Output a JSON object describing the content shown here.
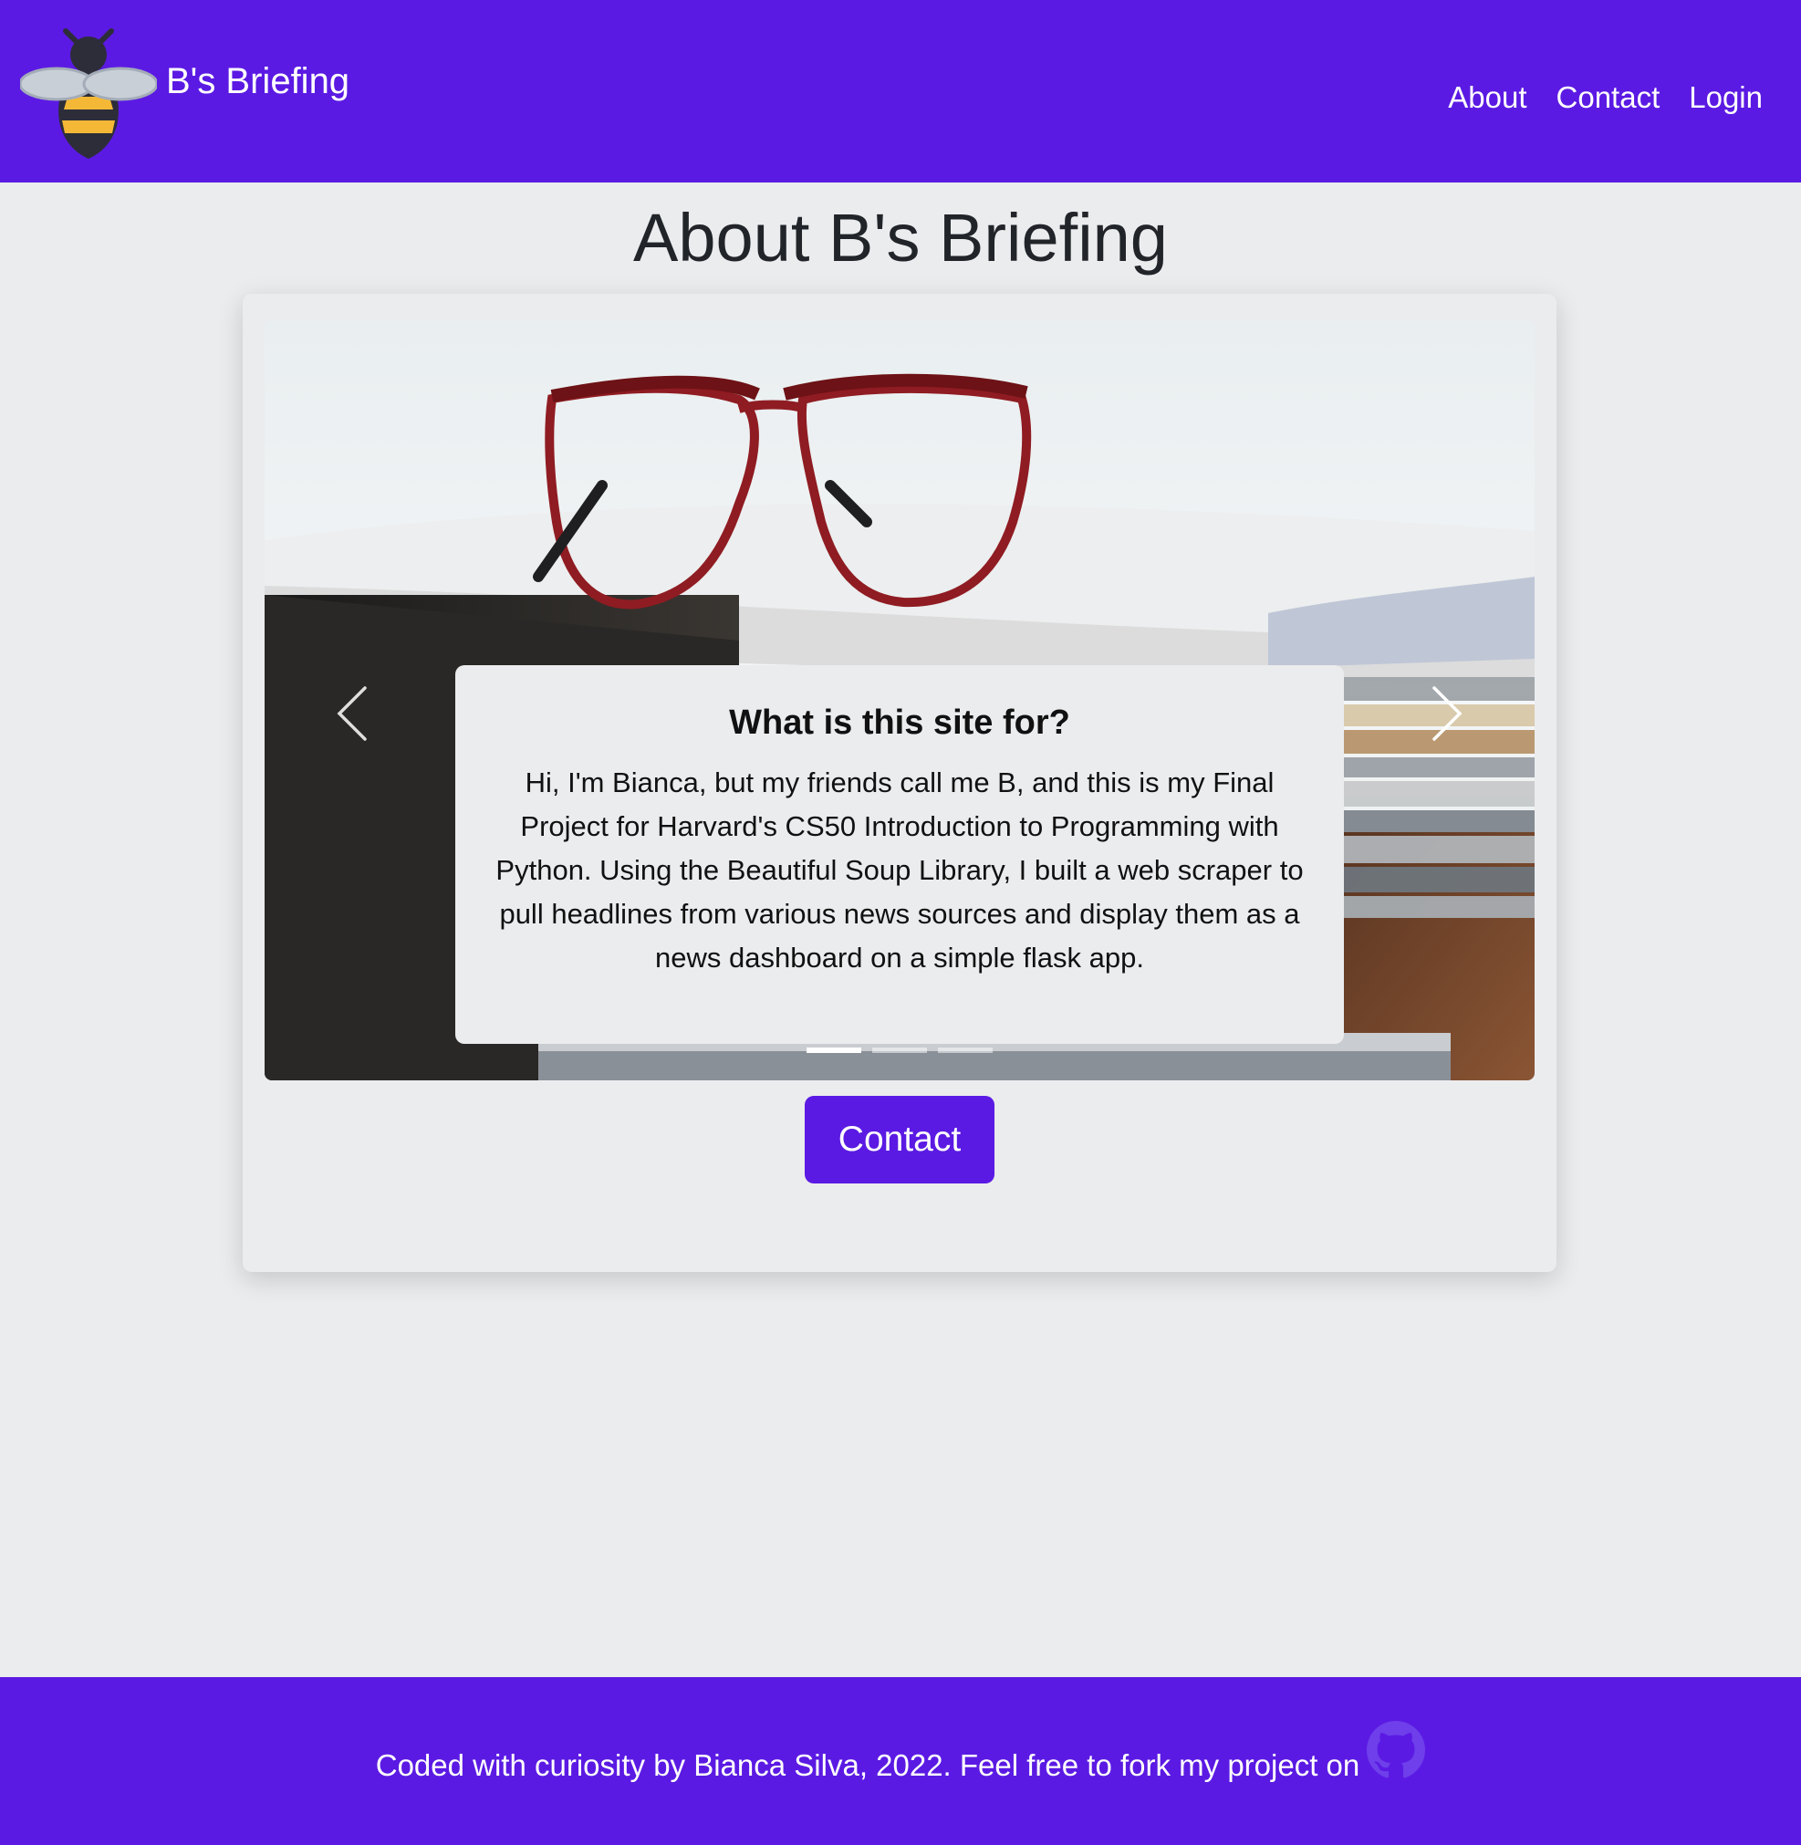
{
  "header": {
    "brand": "B's Briefing",
    "logo_icon": "bee-icon",
    "nav": [
      {
        "label": "About"
      },
      {
        "label": "Contact"
      },
      {
        "label": "Login"
      }
    ]
  },
  "main": {
    "title": "About B's Briefing",
    "carousel": {
      "image": "glasses-on-newspapers",
      "caption_title": "What is this site for?",
      "caption_text": "Hi, I'm Bianca, but my friends call me B, and this is my Final Project for Harvard's CS50 Introduction to Programming with Python. Using the Beautiful Soup Library, I built a web scraper to pull headlines from various news sources and display them as a news dashboard on a simple flask app.",
      "slide_count": 3,
      "active_slide": 1,
      "prev_icon": "chevron-left-icon",
      "next_icon": "chevron-right-icon"
    },
    "contact_button": "Contact"
  },
  "footer": {
    "text": "Coded with curiosity by Bianca Silva, 2022. Feel free to fork my project on",
    "link_icon": "github-icon"
  },
  "colors": {
    "primary": "#5b1ae3",
    "background": "#ebecee",
    "text": "#212429"
  }
}
